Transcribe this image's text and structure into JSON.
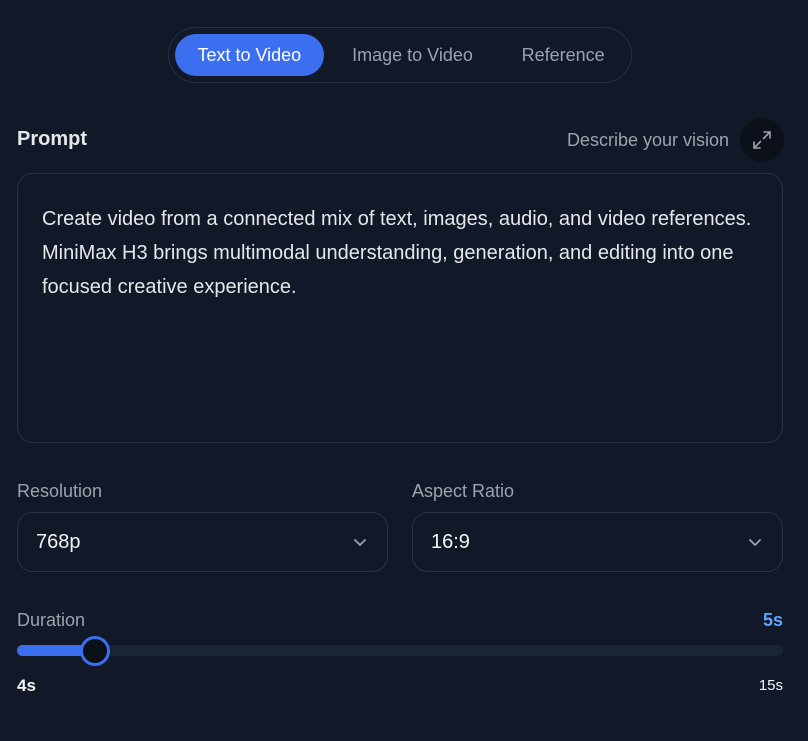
{
  "tabs": [
    {
      "label": "Text to Video",
      "active": true
    },
    {
      "label": "Image to Video",
      "active": false
    },
    {
      "label": "Reference",
      "active": false
    }
  ],
  "prompt": {
    "label": "Prompt",
    "hint": "Describe your vision",
    "expand_icon": "expand-icon",
    "value": "Create video from a connected mix of text, images, audio, and video references. MiniMax H3 brings multimodal understanding, generation, and editing into one focused creative experience."
  },
  "resolution": {
    "label": "Resolution",
    "value": "768p",
    "icon": "chevron-down-icon"
  },
  "aspect_ratio": {
    "label": "Aspect Ratio",
    "value": "16:9",
    "icon": "chevron-down-icon"
  },
  "duration": {
    "label": "Duration",
    "value_label": "5s",
    "value": 5,
    "min": 4,
    "max": 15,
    "min_label": "4s",
    "max_label": "15s"
  },
  "colors": {
    "background": "#111827",
    "accent": "#3b6ff0",
    "accent_text": "#60a5fa"
  }
}
